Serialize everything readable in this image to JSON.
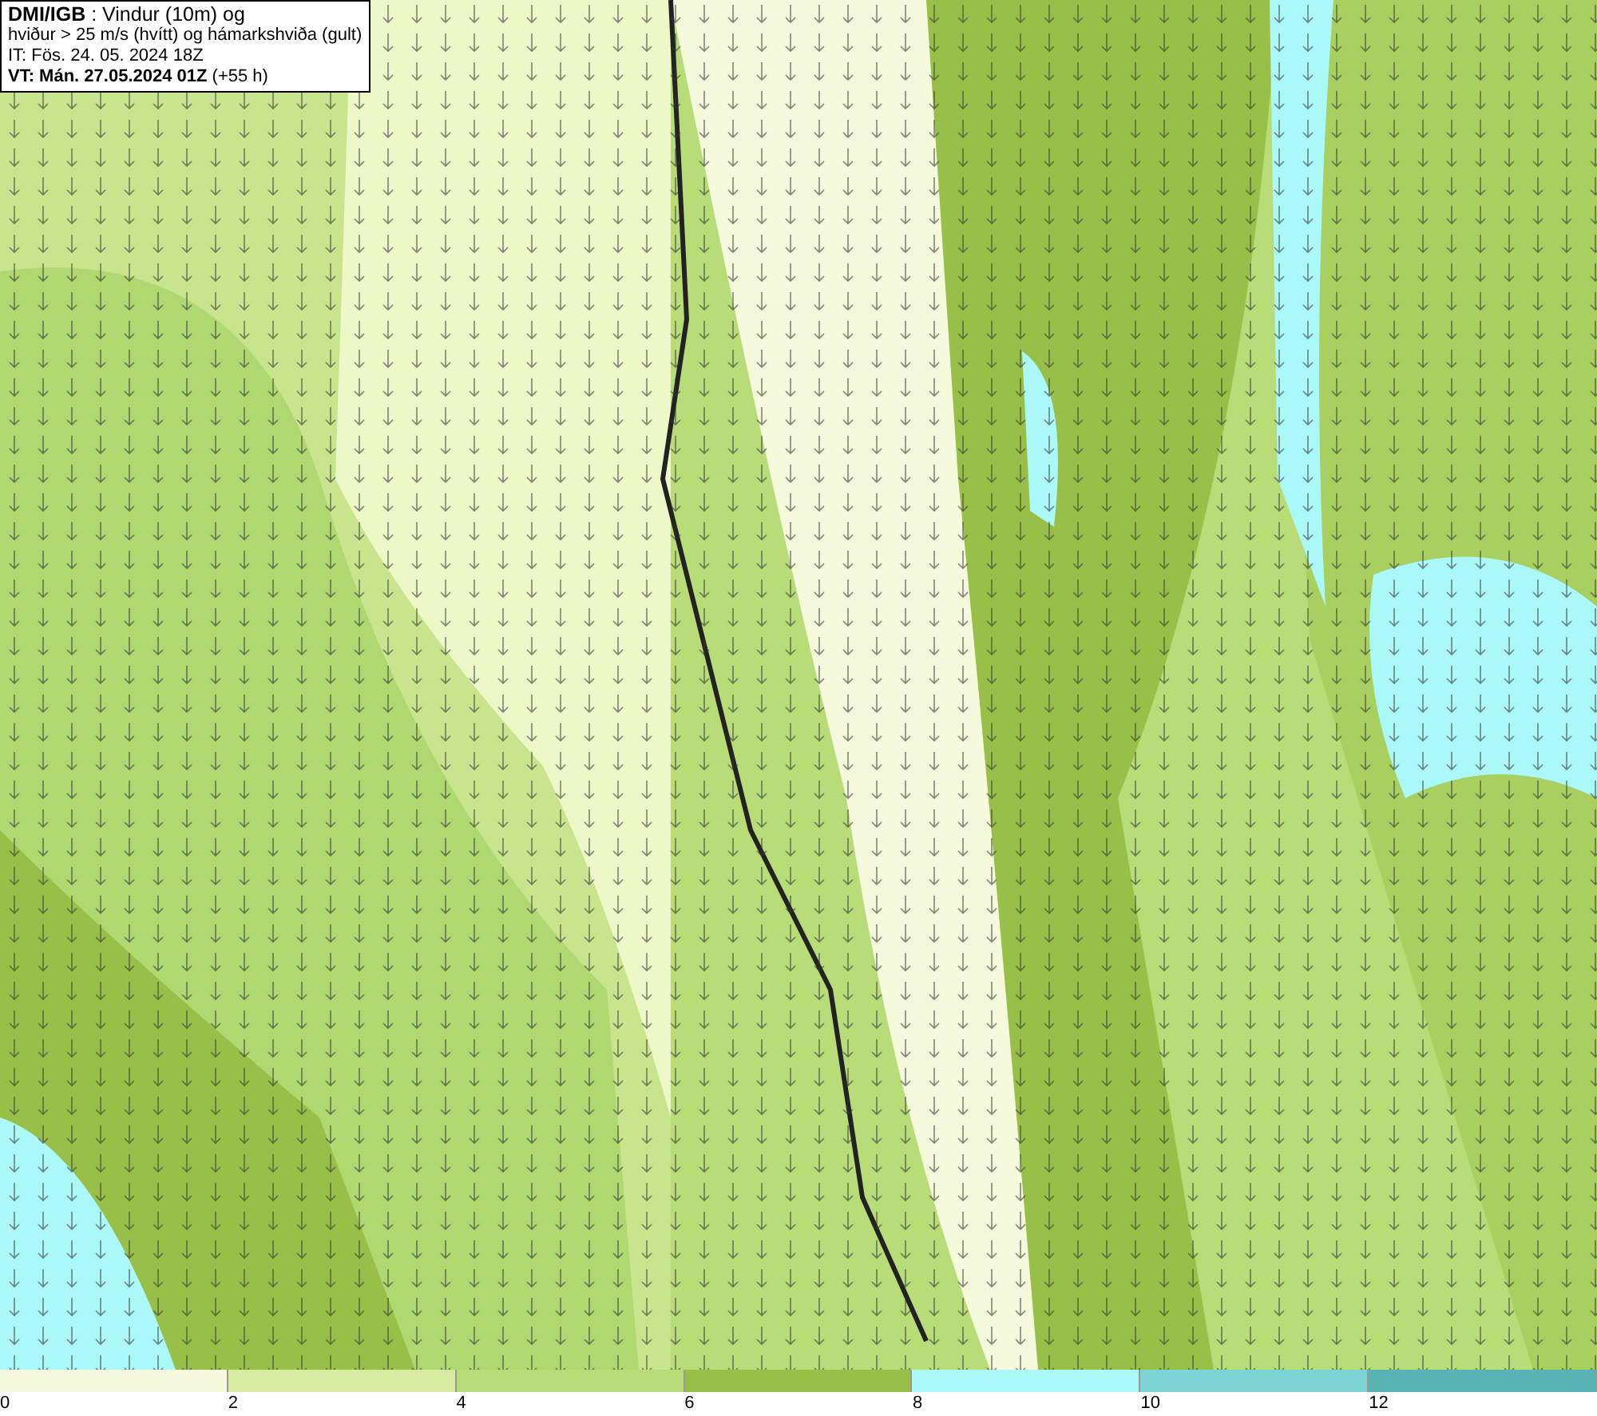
{
  "title_box": {
    "lines": [
      "**DMI/IGB** : Vindur (10m) og",
      "hviður > 25 m/s (hvítt) og hámarkshviða (gult)",
      "IT: Fös. 24. 05. 2024 18Z",
      "**VT: Mán. 27.05.2024 01Z** (+55 h)"
    ]
  },
  "legend": {
    "bins": [
      {
        "label": "0",
        "color": "#f5fadc"
      },
      {
        "label": "2",
        "color": "#d8eca0"
      },
      {
        "label": "4",
        "color": "#b8dc78"
      },
      {
        "label": "6",
        "color": "#98c048"
      },
      {
        "label": "8",
        "color": "#aaf8f8"
      },
      {
        "label": "10",
        "color": "#7cd4d4"
      },
      {
        "label": "12",
        "color": "#58b4b4"
      }
    ]
  }
}
